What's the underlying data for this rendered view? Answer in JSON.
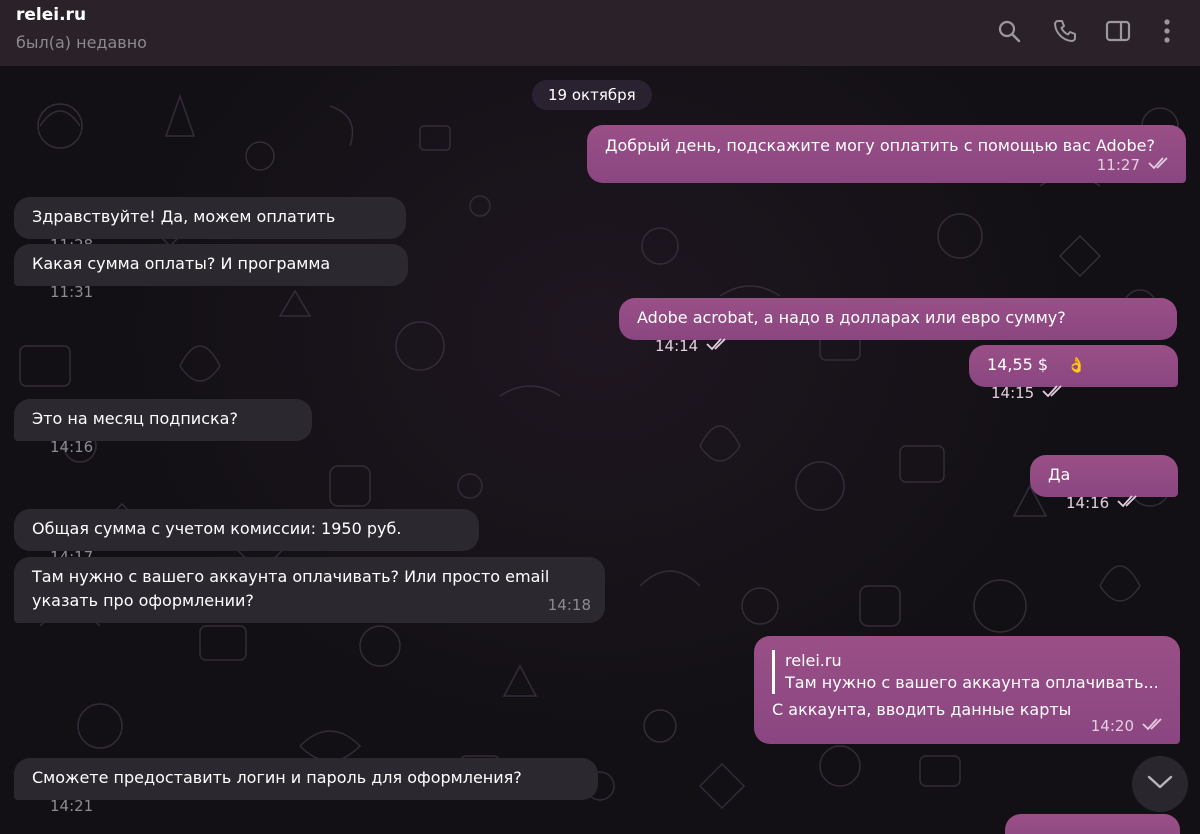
{
  "header": {
    "title": "relei.ru",
    "status": "был(а) недавно",
    "icons": [
      "search-icon",
      "phone-icon",
      "sidebar-toggle-icon",
      "more-vertical-icon"
    ]
  },
  "chat": {
    "date": "19 октября",
    "messages": [
      {
        "dir": "out",
        "text": "Добрый день, подскажите могу оплатить с помощью вас Adobe?",
        "time": "11:27",
        "read": true
      },
      {
        "dir": "in",
        "text": "Здравствуйте! Да, можем оплатить",
        "time": "11:28"
      },
      {
        "dir": "in",
        "text": "Какая сумма оплаты? И программа",
        "time": "11:31"
      },
      {
        "dir": "out",
        "text": "Adobe acrobat, а надо в долларах или евро сумму?",
        "time": "14:14",
        "read": true
      },
      {
        "dir": "out",
        "text": "14,55 $",
        "emoji": "👌",
        "time": "14:15",
        "read": true
      },
      {
        "dir": "in",
        "text": "Это на месяц подписка?",
        "time": "14:16"
      },
      {
        "dir": "out",
        "text": "Да",
        "time": "14:16",
        "read": true
      },
      {
        "dir": "in",
        "text": "Общая сумма с учетом комиссии: 1950 руб.",
        "time": "14:17"
      },
      {
        "dir": "in",
        "text": "Там нужно с вашего аккаунта оплачивать? Или просто email\nуказать про оформлении?",
        "time": "14:18"
      },
      {
        "dir": "out",
        "reply_author": "relei.ru",
        "reply_text": "Там нужно с вашего аккаунта оплачивать...",
        "text": "С аккаунта, вводить данные карты",
        "time": "14:20",
        "read": true
      },
      {
        "dir": "in",
        "text": "Сможете предоставить логин и пароль для оформления?",
        "time": "14:21"
      }
    ]
  },
  "colors": {
    "outgoing_bubble": "#8f4a85",
    "incoming_bubble": "#2c2830",
    "header_bg": "#2b2229",
    "chat_bg": "#121014"
  }
}
